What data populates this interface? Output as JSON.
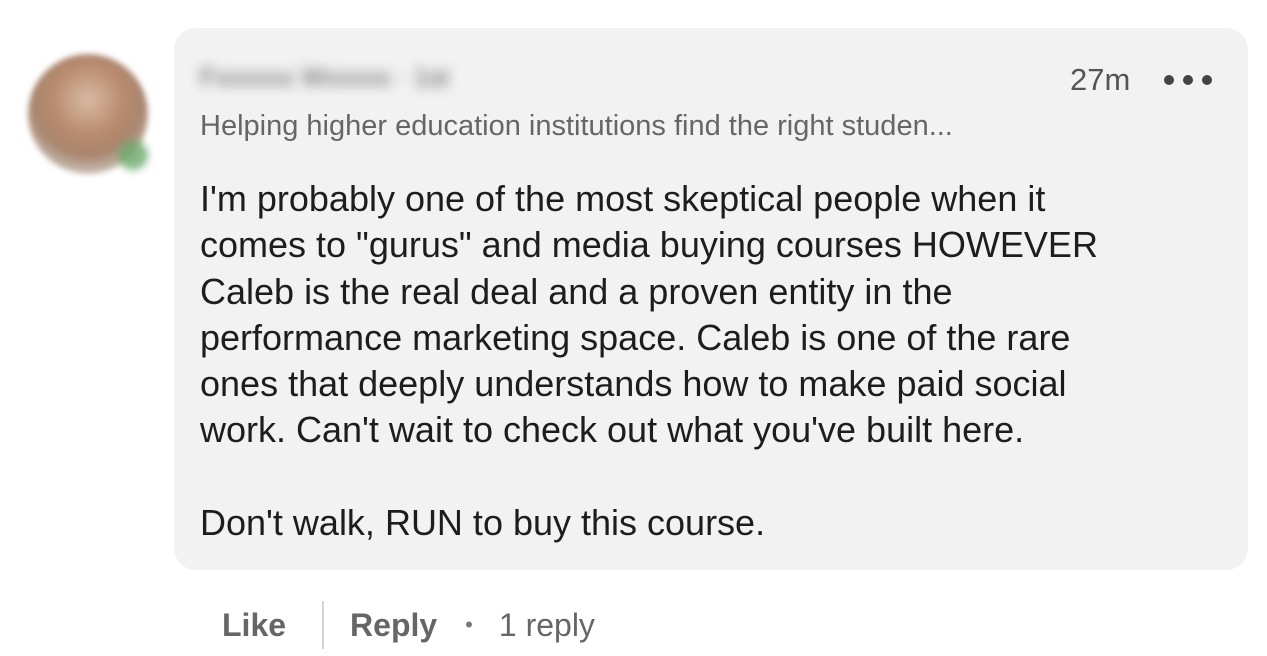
{
  "comment": {
    "author_name": "Fxxxxxx Wxxxxx · 1st",
    "timestamp": "27m",
    "headline": "Helping higher education institutions find the right studen...",
    "body_paragraph_1": "I'm probably one of the most skeptical people when it\ncomes to \"gurus\" and media buying courses HOWEVER\nCaleb is the real deal and a proven entity in the\nperformance marketing space. Caleb is one of the rare\nones that deeply understands how to make paid social\nwork. Can't wait to check out what you've built here.",
    "body_paragraph_2": "Don't walk, RUN to buy this course.",
    "more_icon": "more-horizontal-icon",
    "colors": {
      "bubble_background": "#f2f2f2",
      "text_primary": "#1d1d1d",
      "text_secondary": "#666666"
    }
  },
  "actions": {
    "like_label": "Like",
    "reply_label": "Reply",
    "separator": "•",
    "reply_count": "1 reply"
  }
}
